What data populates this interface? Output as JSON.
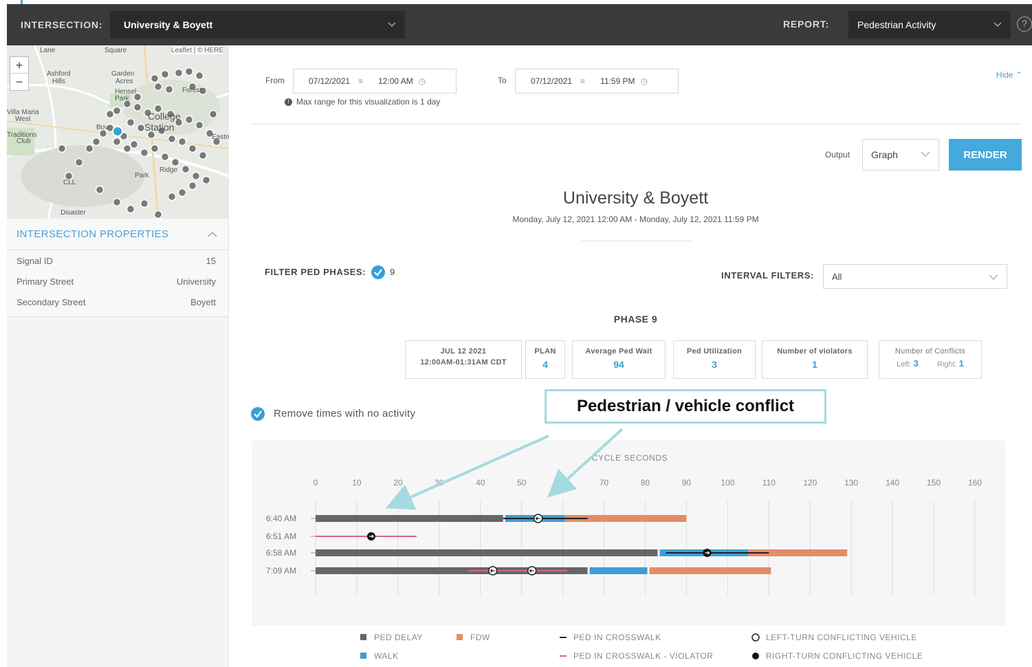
{
  "topbar": {
    "intersection_label": "INTERSECTION:",
    "intersection_value": "University & Boyett",
    "report_label": "REPORT:",
    "report_value": "Pedestrian Activity",
    "help_symbol": "?"
  },
  "map": {
    "attribution": "Leaflet | © HERE",
    "zoom_in": "+",
    "zoom_out": "−",
    "places": [
      "Lane",
      "Square",
      "Ashford Hills",
      "Garden Acres",
      "Oak Forest",
      "Hensel Park",
      "Villa Maria West",
      "Traditions Club",
      "Bov",
      "College Station",
      "Eastma",
      "Ridge",
      "Park",
      "CLL",
      "Disaster"
    ]
  },
  "properties": {
    "title": "INTERSECTION PROPERTIES",
    "rows": [
      {
        "label": "Signal ID",
        "value": "15"
      },
      {
        "label": "Primary Street",
        "value": "University"
      },
      {
        "label": "Secondary Street",
        "value": "Boyett"
      }
    ]
  },
  "range": {
    "from_label": "From",
    "from_date": "07/12/2021",
    "from_time": "12:00 AM",
    "to_label": "To",
    "to_date": "07/12/2021",
    "to_time": "11:59 PM",
    "note": "Max range for this visualization is 1 day",
    "hide": "Hide"
  },
  "output": {
    "label": "Output",
    "value": "Graph",
    "render": "RENDER"
  },
  "report": {
    "title": "University & Boyett",
    "subtitle": "Monday, July 12, 2021 12:00 AM - Monday, July 12, 2021 11:59 PM"
  },
  "filters": {
    "ped_label": "FILTER PED PHASES:",
    "ped_value": "9",
    "interval_label": "INTERVAL FILTERS:",
    "interval_value": "All",
    "remove_label": "Remove times with no activity"
  },
  "phase": {
    "title": "PHASE 9",
    "cards": [
      {
        "title": "JUL 12 2021",
        "value": "12:00AM-01:31AM CDT"
      },
      {
        "title": "PLAN",
        "value": "4"
      },
      {
        "title": "Average Ped Wait",
        "value": "94"
      },
      {
        "title": "Ped Utilization",
        "value": "3"
      },
      {
        "title": "Number of violators",
        "value": "1"
      },
      {
        "title": "Number of Conflicts",
        "left_label": "Left:",
        "left_value": "3",
        "right_label": "Right:",
        "right_value": "1"
      }
    ]
  },
  "callout": "Pedestrian / vehicle conflict",
  "chart_data": {
    "type": "bar",
    "title": "CYCLE SECONDS",
    "xlim": [
      0,
      160
    ],
    "xticks": [
      0,
      10,
      20,
      30,
      40,
      50,
      60,
      70,
      80,
      90,
      100,
      110,
      120,
      130,
      140,
      150,
      160
    ],
    "rows": [
      {
        "time": "6:40 AM",
        "ped_delay": [
          0,
          45.5
        ],
        "walk": [
          46,
          60.5
        ],
        "fdw": [
          60.5,
          90
        ],
        "crosswalk": [
          45.5,
          66
        ],
        "violator": null,
        "left_turn": [
          54
        ],
        "right_turn": []
      },
      {
        "time": "6:51 AM",
        "ped_delay": null,
        "walk": null,
        "fdw": null,
        "crosswalk": null,
        "violator": [
          0,
          24.5
        ],
        "left_turn": [],
        "right_turn": [
          13.5
        ]
      },
      {
        "time": "6:58 AM",
        "ped_delay": [
          0,
          83
        ],
        "walk": [
          83.5,
          105
        ],
        "fdw": [
          105,
          129
        ],
        "crosswalk": [
          85,
          110
        ],
        "violator": null,
        "left_turn": [],
        "right_turn": [
          95
        ]
      },
      {
        "time": "7:09 AM",
        "ped_delay": [
          0,
          66
        ],
        "walk": [
          66.5,
          80.5
        ],
        "fdw": [
          81,
          110.5
        ],
        "crosswalk": null,
        "violator": [
          37,
          61
        ],
        "left_turn": [
          43,
          52.5
        ],
        "right_turn": []
      }
    ],
    "legend": [
      {
        "label": "PED DELAY",
        "color": "#666666",
        "shape": "square"
      },
      {
        "label": "FDW",
        "color": "#e58c66",
        "shape": "square"
      },
      {
        "label": "PED IN CROSSWALK",
        "color": "#222222",
        "shape": "line"
      },
      {
        "label": "LEFT-TURN CONFLICTING VEHICLE",
        "color": "#222222",
        "shape": "left-circle"
      },
      {
        "label": "WALK",
        "color": "#3a9fd5",
        "shape": "square"
      },
      {
        "label": "PED IN CROSSWALK - VIOLATOR",
        "color": "#d9667f",
        "shape": "line"
      },
      {
        "label": "RIGHT-TURN CONFLICTING VEHICLE",
        "color": "#111111",
        "shape": "right-circle"
      }
    ]
  }
}
